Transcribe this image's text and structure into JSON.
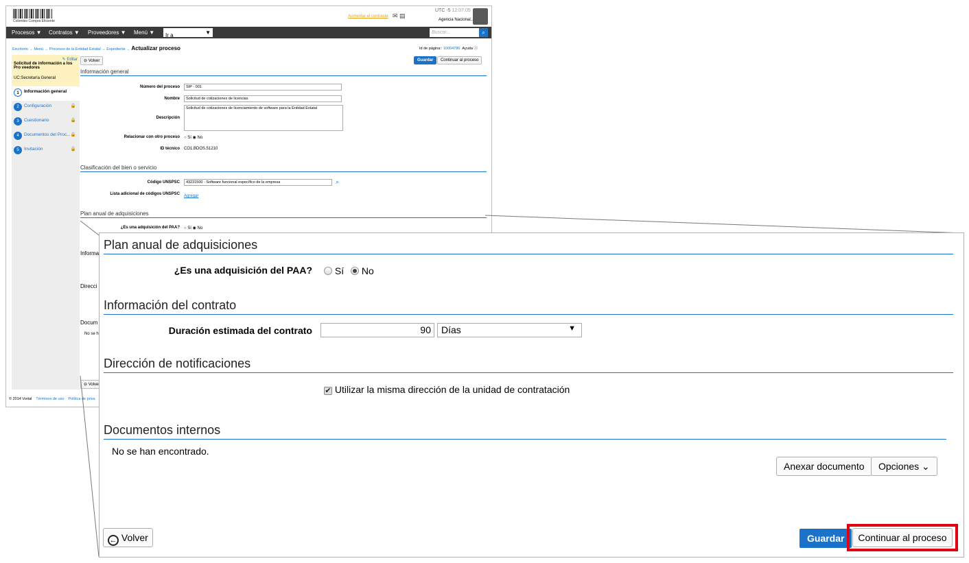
{
  "header": {
    "logo_text": "Colombio Compra Eficiente",
    "contrast_link": "Aumentar el contraste",
    "timezone": "UTC -5",
    "time": "12:07:05",
    "agency": "Agencia Nacional...",
    "search_placeholder": "Buscar..."
  },
  "nav": {
    "items": [
      "Procesos",
      "Contratos",
      "Proveedores",
      "Menú"
    ],
    "goto": "Ir a"
  },
  "breadcrumb": {
    "path": "Escritorio → Menú → Procesos de la Entidad Estatal → Expediente →",
    "current": "Actualizar proceso",
    "page_id_label": "Id de página::",
    "page_id": "10004786",
    "help": "Ayuda"
  },
  "sidebar": {
    "edit": "Editar",
    "title": "Solicitud de información a los Pro veedores",
    "unit": "UC:Secretaría General",
    "steps": [
      {
        "num": "1",
        "label": "Información general"
      },
      {
        "num": "2",
        "label": "Configuración"
      },
      {
        "num": "3",
        "label": "Cuestionario"
      },
      {
        "num": "4",
        "label": "Documentos del Proc..."
      },
      {
        "num": "5",
        "label": "Invitación"
      }
    ]
  },
  "form": {
    "back": "Volver",
    "save": "Guardar",
    "continue": "Continuar al proceso",
    "sec_general": "Información general",
    "num_label": "Número del proceso",
    "num_value": "SIP - 001",
    "name_label": "Nombre",
    "name_value": "Solicitud de cotizaciones de licencias",
    "desc_label": "Descripción",
    "desc_value": "Solicitud de cotizaciones de licenciamiento de software para la Entidad Estatal",
    "relate_label": "Relacionar con otro proceso",
    "yes": "Sí",
    "no": "No",
    "tech_label": "ID técnico",
    "tech_value": "CO1.BDOS.51210",
    "sec_class": "Clasificación del bien o servicio",
    "unspsc_label": "Código UNSPSC",
    "unspsc_value": "43231500 - Software funcional específico de la empresa",
    "extra_label": "Lista adicional de códigos UNSPSC",
    "add": "Agregar",
    "sec_paa": "Plan anual de adquisiciones",
    "paa_label": "¿Es una adquisición del PAA?",
    "bg_trunc": [
      "Informa",
      "Direcci",
      "Docum",
      "No se h"
    ]
  },
  "footer": {
    "copyright": "© 2014 Vortal",
    "terms": "Términos de uso",
    "privacy": "Política de priva"
  },
  "zoom": {
    "sec_paa": "Plan anual de adquisiciones",
    "paa_label": "¿Es una adquisición del PAA?",
    "yes": "Sí",
    "no": "No",
    "sec_contract": "Información del contrato",
    "duration_label": "Duración estimada del contrato",
    "duration_value": "90",
    "duration_unit": "Días",
    "sec_notify": "Dirección de notificaciones",
    "same_address": "Utilizar la misma dirección de la unidad de contratación",
    "sec_docs": "Documentos internos",
    "not_found": "No se han encontrado.",
    "attach": "Anexar documento",
    "options": "Opciones",
    "back": "Volver",
    "save": "Guardar",
    "continue": "Continuar al proceso"
  },
  "colors": {
    "accent": "#1a73c9",
    "nav_bg": "#3a3a3a",
    "highlight": "#e0000f",
    "sidebar_header": "#fdf2c0"
  }
}
